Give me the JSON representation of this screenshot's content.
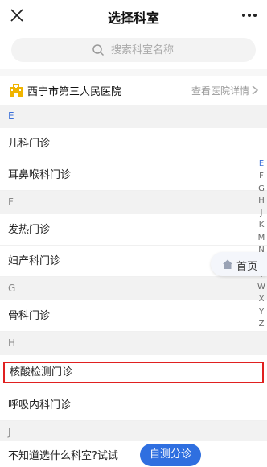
{
  "header": {
    "title": "选择科室",
    "close_icon": "close-icon",
    "more_icon": "more-icon"
  },
  "search": {
    "placeholder": "搜索科室名称"
  },
  "hospital": {
    "name": "西宁市第三人民医院",
    "detail_link": "查看医院详情"
  },
  "sections": [
    {
      "letter": "E",
      "depts": [
        "儿科门诊",
        "耳鼻喉科门诊"
      ]
    },
    {
      "letter": "F",
      "depts": [
        "发热门诊",
        "妇产科门诊"
      ]
    },
    {
      "letter": "G",
      "depts": [
        "骨科门诊"
      ]
    },
    {
      "letter": "H",
      "depts": [
        "核酸检测门诊",
        "呼吸内科门诊"
      ]
    },
    {
      "letter": "J",
      "depts": []
    }
  ],
  "index_letters": [
    "E",
    "F",
    "G",
    "H",
    "J",
    "K",
    "M",
    "N",
    "S",
    "T",
    "W",
    "X",
    "Y",
    "Z"
  ],
  "active_letter": "E",
  "home_float": {
    "label": "首页"
  },
  "bottom": {
    "prompt": "不知道选什么科室?试试",
    "button": "自测分诊"
  },
  "colors": {
    "accent": "#2f6fe0",
    "highlight_border": "#e02020",
    "section_bg": "#f2f2f2"
  }
}
